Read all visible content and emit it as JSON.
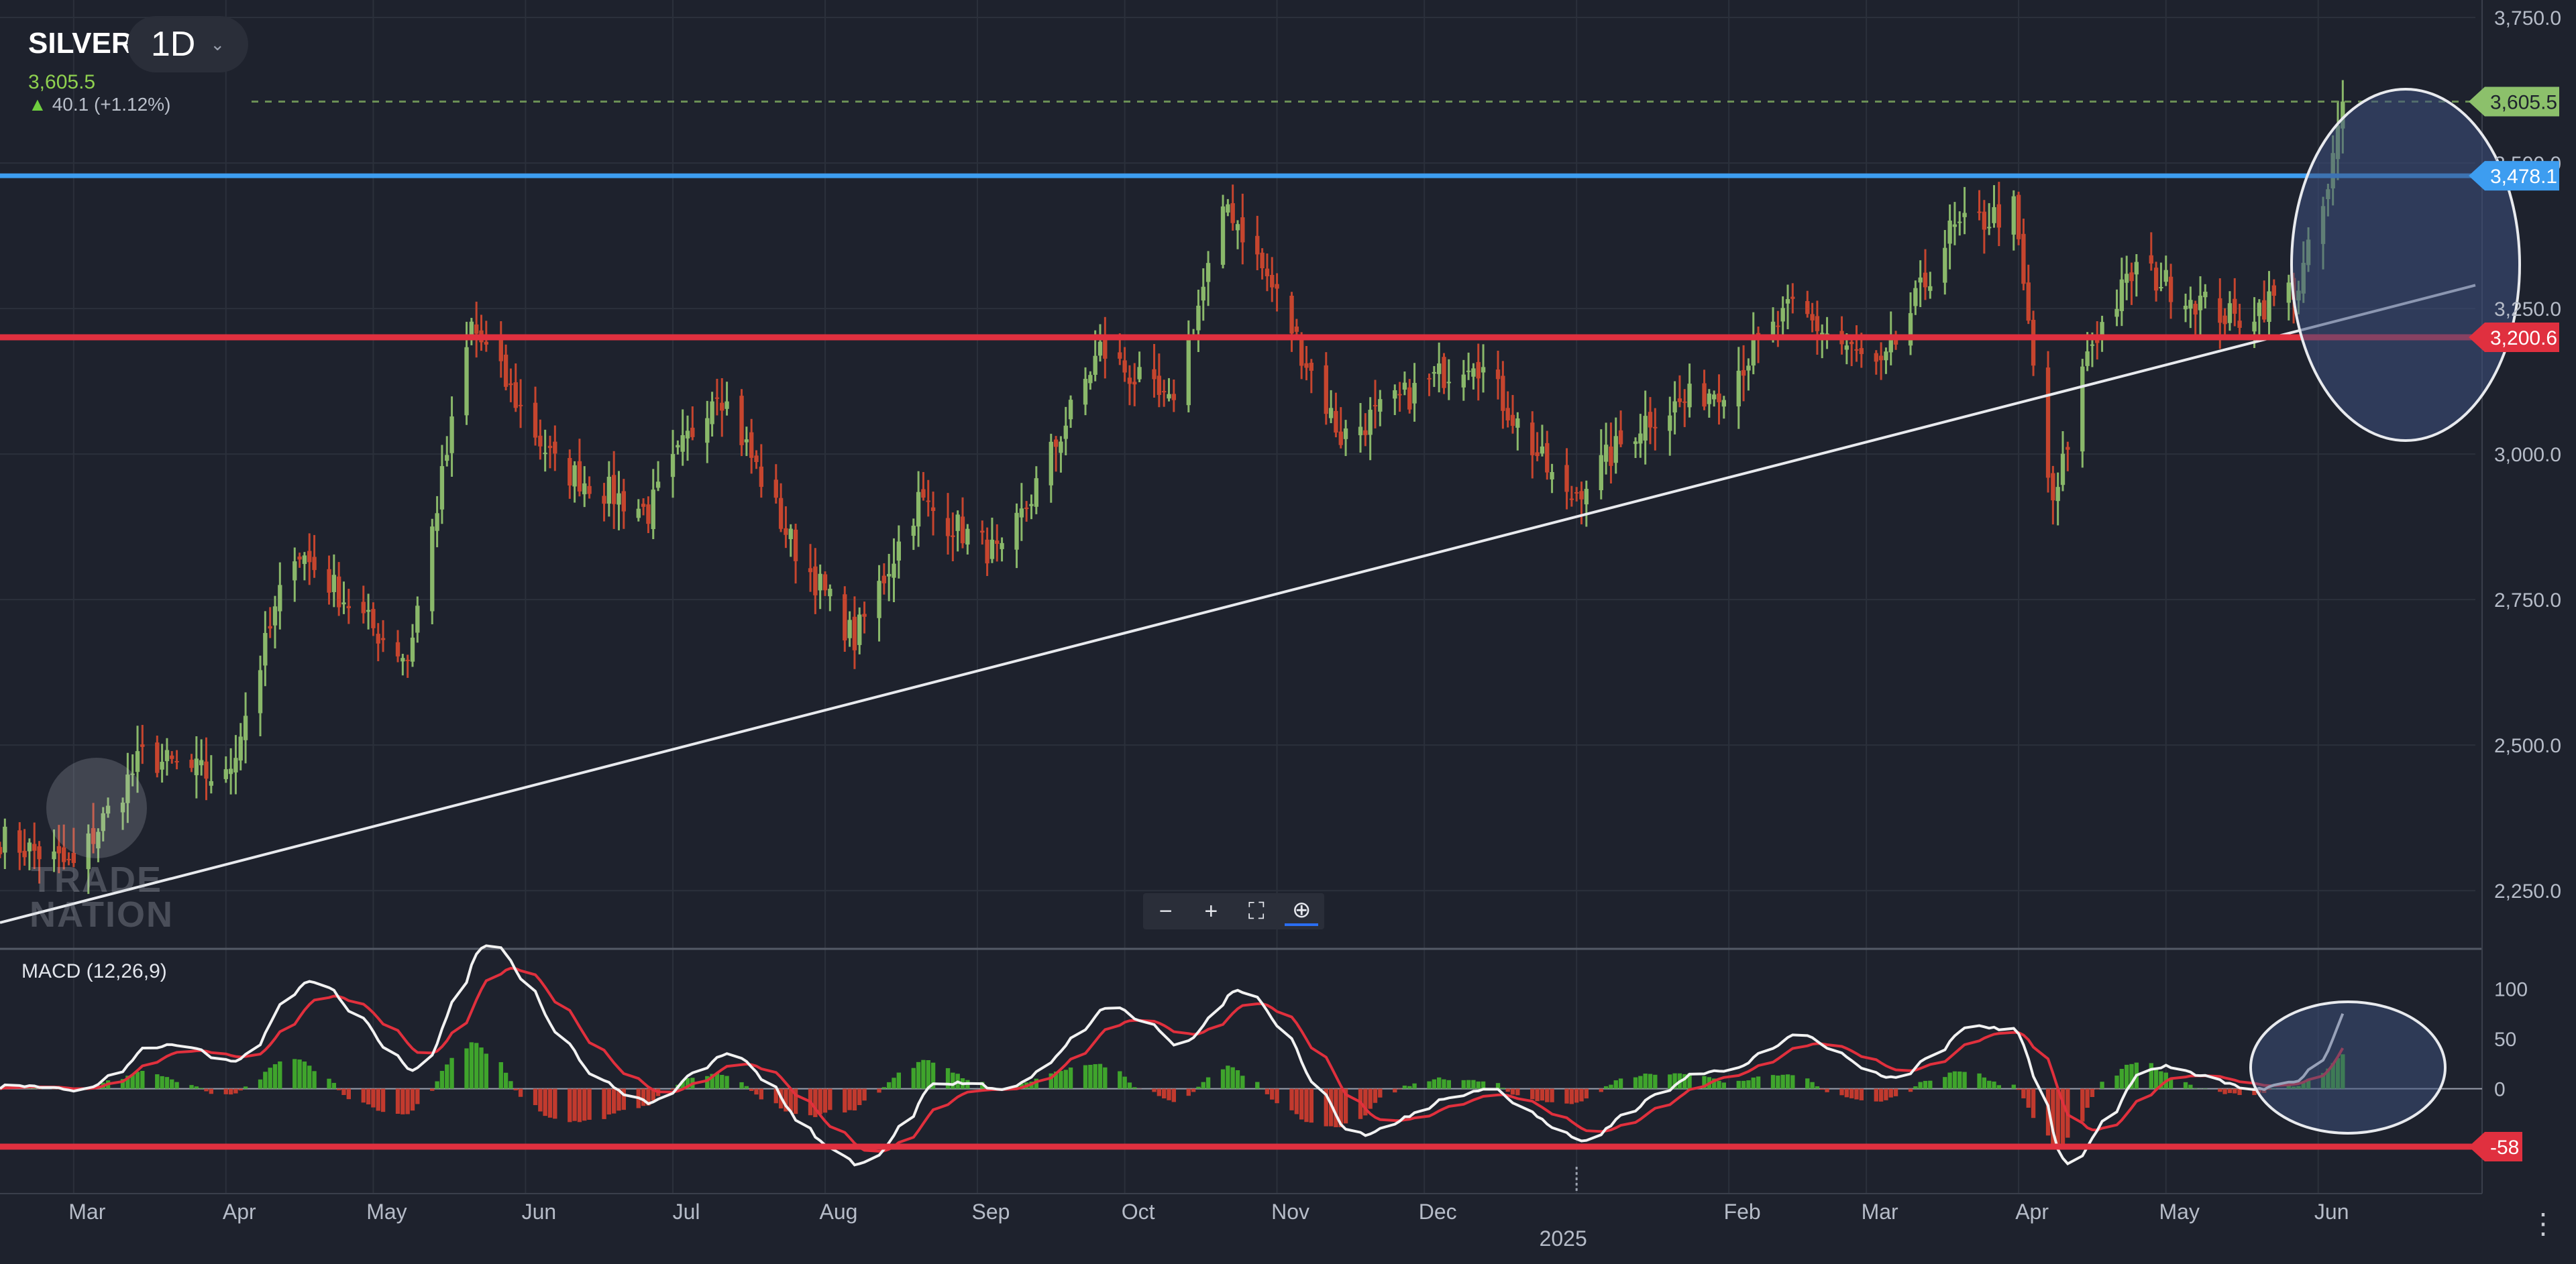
{
  "header": {
    "symbol": "SILVER",
    "timeframe": "1D",
    "last_price": "3,605.5",
    "change": "40.1 (+1.12%)"
  },
  "watermark": {
    "line1": "TRADE",
    "line2": "NATION"
  },
  "macd_label": "MACD (12,26,9)",
  "zoom_controls": {
    "zoom_out": "−",
    "zoom_in": "+",
    "fit": "⛶",
    "reset": "⊕"
  },
  "menu": "⋮",
  "colors": {
    "background": "#1e222d",
    "up": "#8ab86a",
    "down": "#c6452e",
    "resistance": "#3d9df0",
    "support": "#e0303f",
    "trendline": "#e8eaee",
    "price_tag": "#8cc06b",
    "macd_line": "#f2f2f2",
    "signal_line": "#e1303d",
    "hist_up": "#3fa42c",
    "hist_down": "#c23a2e",
    "highlight": "#3e5180"
  },
  "chart_data": [
    {
      "type": "candlestick",
      "ylim": [
        2150,
        3780
      ],
      "y_ticks": [
        "2,250.0",
        "2,500.0",
        "2,750.0",
        "3,000.0",
        "3,250.0",
        "3,500.0",
        "3,750.0"
      ],
      "y_tick_values": [
        2250,
        2500,
        2750,
        3000,
        3250,
        3500,
        3750
      ],
      "x_labels": [
        "Mar",
        "Apr",
        "May",
        "Jun",
        "Jul",
        "Aug",
        "Sep",
        "Oct",
        "Nov",
        "Dec",
        "2025",
        "Feb",
        "Mar",
        "Apr",
        "May",
        "Jun"
      ],
      "x_label_dates": [
        "2024-03-01",
        "2024-04-01",
        "2024-05-01",
        "2024-06-01",
        "2024-07-01",
        "2024-08-01",
        "2024-09-01",
        "2024-10-01",
        "2024-11-01",
        "2024-12-01",
        "2025-01-01",
        "2025-02-01",
        "2025-03-01",
        "2025-04-01",
        "2025-05-01",
        "2025-06-01"
      ],
      "x_range": [
        "2024-02-15",
        "2025-07-03"
      ],
      "key_points": [
        {
          "date": "2024-02-15",
          "close": 2340
        },
        {
          "date": "2024-03-01",
          "close": 2290
        },
        {
          "date": "2024-03-15",
          "close": 2480
        },
        {
          "date": "2024-04-01",
          "close": 2440
        },
        {
          "date": "2024-04-15",
          "close": 2840
        },
        {
          "date": "2024-05-01",
          "close": 2700
        },
        {
          "date": "2024-05-08",
          "close": 2650
        },
        {
          "date": "2024-05-21",
          "close": 3220
        },
        {
          "date": "2024-06-07",
          "close": 2980
        },
        {
          "date": "2024-06-26",
          "close": 2900
        },
        {
          "date": "2024-07-10",
          "close": 3120
        },
        {
          "date": "2024-07-25",
          "close": 2850
        },
        {
          "date": "2024-08-07",
          "close": 2680
        },
        {
          "date": "2024-08-20",
          "close": 2920
        },
        {
          "date": "2024-09-06",
          "close": 2820
        },
        {
          "date": "2024-09-26",
          "close": 3180
        },
        {
          "date": "2024-10-10",
          "close": 3080
        },
        {
          "date": "2024-10-22",
          "close": 3430
        },
        {
          "date": "2024-11-01",
          "close": 3270
        },
        {
          "date": "2024-11-14",
          "close": 3030
        },
        {
          "date": "2024-12-11",
          "close": 3170
        },
        {
          "date": "2024-12-30",
          "close": 2920
        },
        {
          "date": "2025-01-15",
          "close": 3060
        },
        {
          "date": "2025-01-31",
          "close": 3120
        },
        {
          "date": "2025-02-14",
          "close": 3250
        },
        {
          "date": "2025-03-04",
          "close": 3140
        },
        {
          "date": "2025-03-18",
          "close": 3380
        },
        {
          "date": "2025-03-31",
          "close": 3420
        },
        {
          "date": "2025-04-04",
          "close": 3150
        },
        {
          "date": "2025-04-08",
          "close": 2900
        },
        {
          "date": "2025-04-15",
          "close": 3180
        },
        {
          "date": "2025-04-25",
          "close": 3320
        },
        {
          "date": "2025-05-15",
          "close": 3230
        },
        {
          "date": "2025-05-28",
          "close": 3290
        },
        {
          "date": "2025-06-03",
          "close": 3450
        },
        {
          "date": "2025-06-06",
          "close": 3605.5
        }
      ],
      "levels": [
        {
          "value": 3478.1,
          "label": "3,478.1",
          "role": "resistance"
        },
        {
          "value": 3200.6,
          "label": "3,200.6",
          "role": "support"
        },
        {
          "value": 3605.5,
          "label": "3,605.5",
          "role": "last"
        }
      ],
      "trendline": [
        {
          "date": "2024-02-15",
          "value": 2195
        },
        {
          "date": "2025-07-03",
          "value": 3290
        }
      ]
    },
    {
      "type": "macd",
      "label": "MACD (12,26,9)",
      "ylim": [
        -105,
        140
      ],
      "y_ticks": [
        "100",
        "50",
        "0",
        "-58"
      ],
      "y_tick_values": [
        100,
        50,
        0,
        -58
      ],
      "level": {
        "value": -58,
        "label": "-58"
      }
    }
  ]
}
